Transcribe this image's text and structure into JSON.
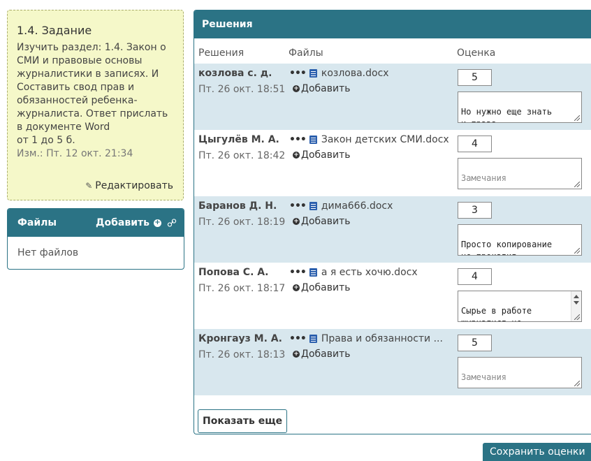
{
  "task": {
    "title": "1.4. Задание",
    "text": "Изучить раздел: 1.4. Закон о\nСМИ и правовые основы\nжурналистики в записях. И\nСоставить свод прав и\nобязанностей ребенка-\nжурналиста. Ответ прислать\nв документе Word",
    "range": "от 1 до 5 б.",
    "modified": "Изм.: Пт. 12 окт. 21:34",
    "edit_label": "Редактировать"
  },
  "files_panel": {
    "title": "Файлы",
    "add_label": "Добавить",
    "empty_text": "Нет файлов"
  },
  "solutions": {
    "title": "Решения",
    "columns": {
      "solutions": "Решения",
      "files": "Файлы",
      "grade": "Оценка"
    },
    "add_file_label": "Добавить",
    "remark_placeholder": "Замечания",
    "rows": [
      {
        "name": "козлова с. д.",
        "date": "Пт. 26 окт. 18:51",
        "file": "козлова.docx",
        "grade": "5",
        "remark": "Но нужно еще знать\nи права."
      },
      {
        "name": "Цыгулёв М. А.",
        "date": "Пт. 26 окт. 18:42",
        "file": "Закон детских СМИ.docx",
        "grade": "4",
        "remark": ""
      },
      {
        "name": "Баранов Д. Н.",
        "date": "Пт. 26 окт. 18:19",
        "file": "дима666.docx",
        "grade": "3",
        "remark": "Просто копирование\nне прокатит"
      },
      {
        "name": "Попова С. А.",
        "date": "Пт. 26 окт. 18:17",
        "file": "а я есть хочю.docx",
        "grade": "4",
        "remark": "Сырье в работе\nжурналист не"
      },
      {
        "name": "Кронгауз М. А.",
        "date": "Пт. 26 окт. 18:13",
        "file": "Права и обязанности ...",
        "grade": "5",
        "remark": ""
      }
    ],
    "show_more_label": "Показать еще"
  },
  "save_label": "Сохранить оценки",
  "colors": {
    "accent": "#2b7385",
    "row_alt": "#d8e7ee",
    "task_bg": "#f5f8c9"
  }
}
